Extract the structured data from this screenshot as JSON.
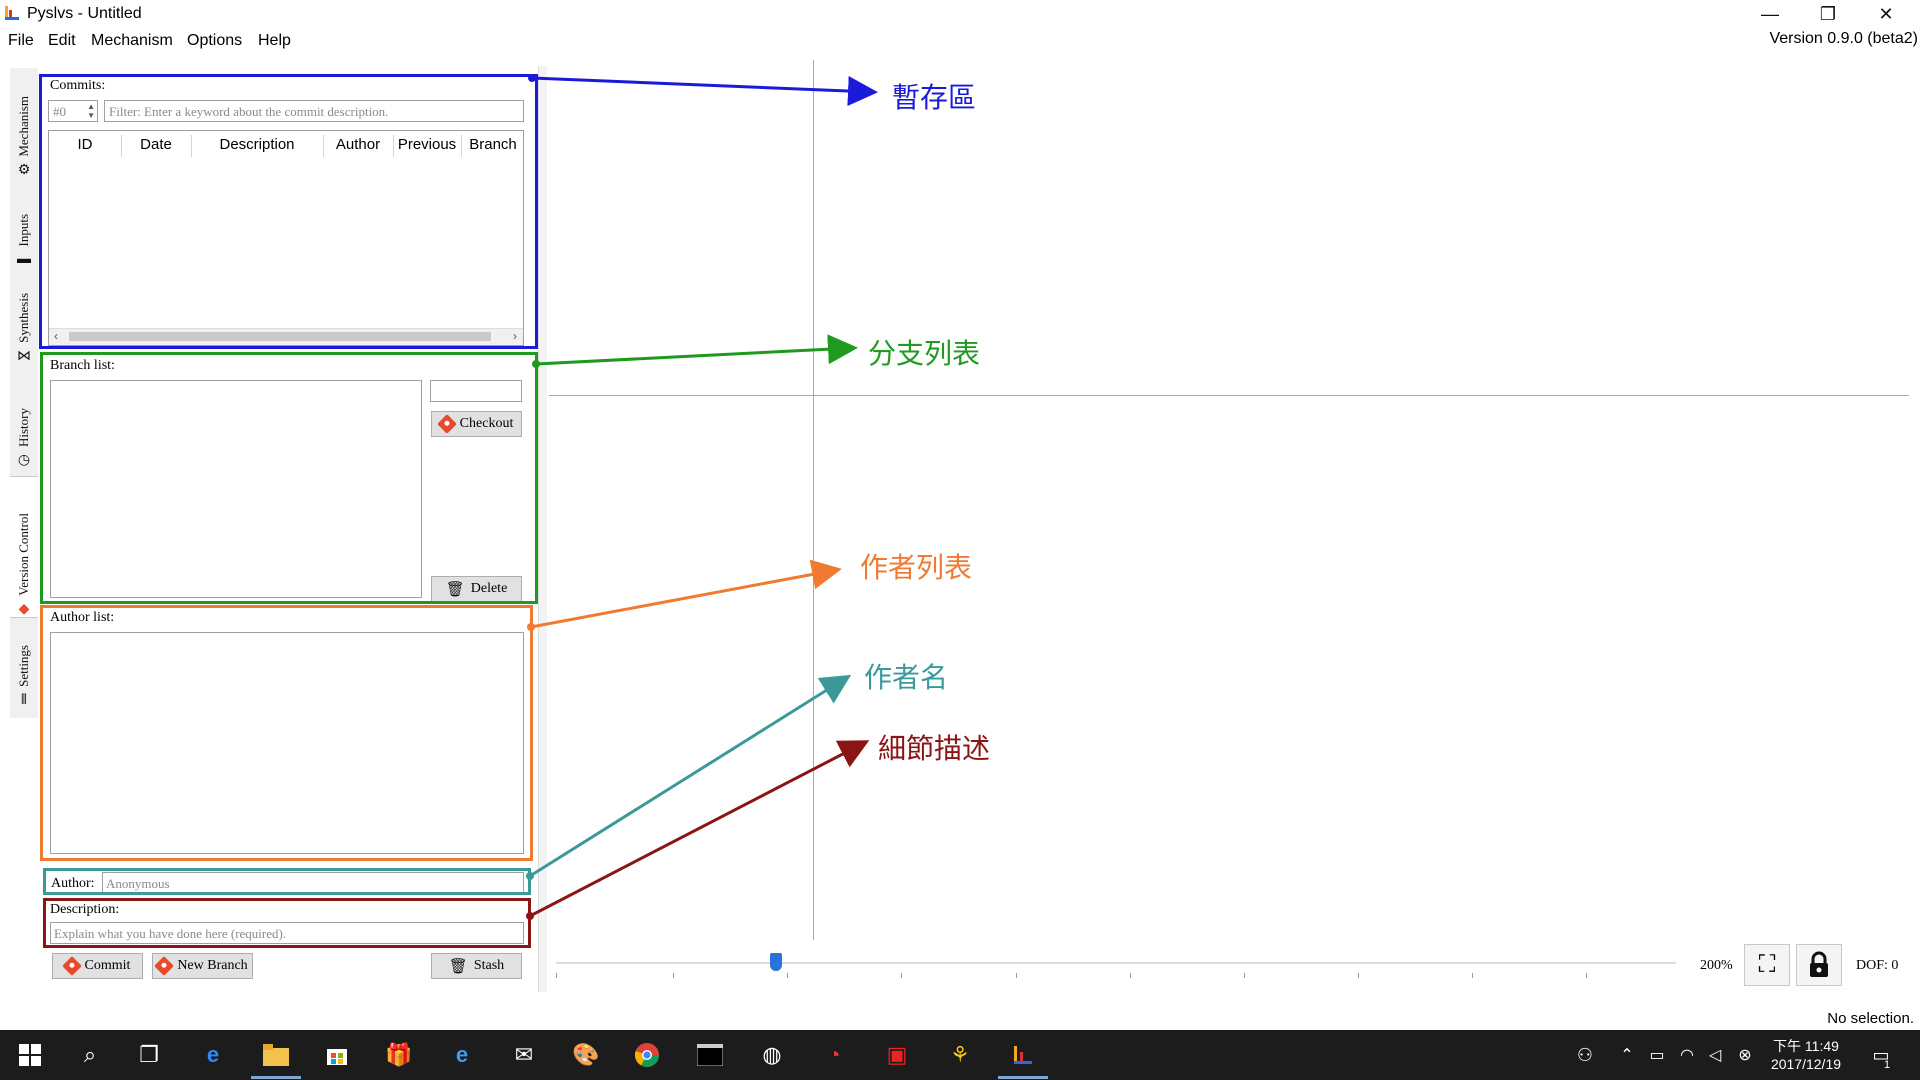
{
  "window": {
    "title": "Pyslvs - Untitled",
    "version": "Version 0.9.0 (beta2)",
    "controls": {
      "minimize": "—",
      "maximize": "❐",
      "close": "✕"
    }
  },
  "menu": [
    "File",
    "Edit",
    "Mechanism",
    "Options",
    "Help"
  ],
  "side_tabs": [
    {
      "label": "Mechanism",
      "icon": "gear-icon",
      "glyph": "⚙"
    },
    {
      "label": "Inputs",
      "icon": "input-icon",
      "glyph": "▬"
    },
    {
      "label": "Synthesis",
      "icon": "synthesis-icon",
      "glyph": "⋈"
    },
    {
      "label": "History",
      "icon": "clock-icon",
      "glyph": "◷"
    },
    {
      "label": "Version Control",
      "icon": "git-icon",
      "glyph": "◆",
      "active": true
    },
    {
      "label": "Settings",
      "icon": "sliders-icon",
      "glyph": "⫴"
    }
  ],
  "commits": {
    "label": "Commits:",
    "spin_value": "#0",
    "filter_placeholder": "Filter: Enter a keyword about the commit description.",
    "columns": [
      "ID",
      "Date",
      "Description",
      "Author",
      "Previous",
      "Branch"
    ],
    "rows": []
  },
  "branch": {
    "label": "Branch list:",
    "name_input": "",
    "checkout": "Checkout",
    "delete": "Delete",
    "items": []
  },
  "author": {
    "list_label": "Author list:",
    "items": [],
    "name_label": "Author:",
    "name_placeholder": "Anonymous"
  },
  "description": {
    "label": "Description:",
    "placeholder": "Explain what you have done here (required)."
  },
  "buttons": {
    "commit": "Commit",
    "new_branch": "New Branch",
    "stash": "Stash"
  },
  "canvas": {
    "zoom": "200%",
    "dof": "DOF: 0",
    "zoom_level": 0.2
  },
  "status": "No selection.",
  "annotations": [
    {
      "text": "暫存區",
      "color": "#1a1adb"
    },
    {
      "text": "分支列表",
      "color": "#1f9a1f"
    },
    {
      "text": "作者列表",
      "color": "#f07a30"
    },
    {
      "text": "作者名",
      "color": "#3a9a9a"
    },
    {
      "text": "細節描述",
      "color": "#8b1414"
    }
  ],
  "taskbar": {
    "time": "下午 11:49",
    "date": "2017/12/19",
    "notifications": "1"
  }
}
